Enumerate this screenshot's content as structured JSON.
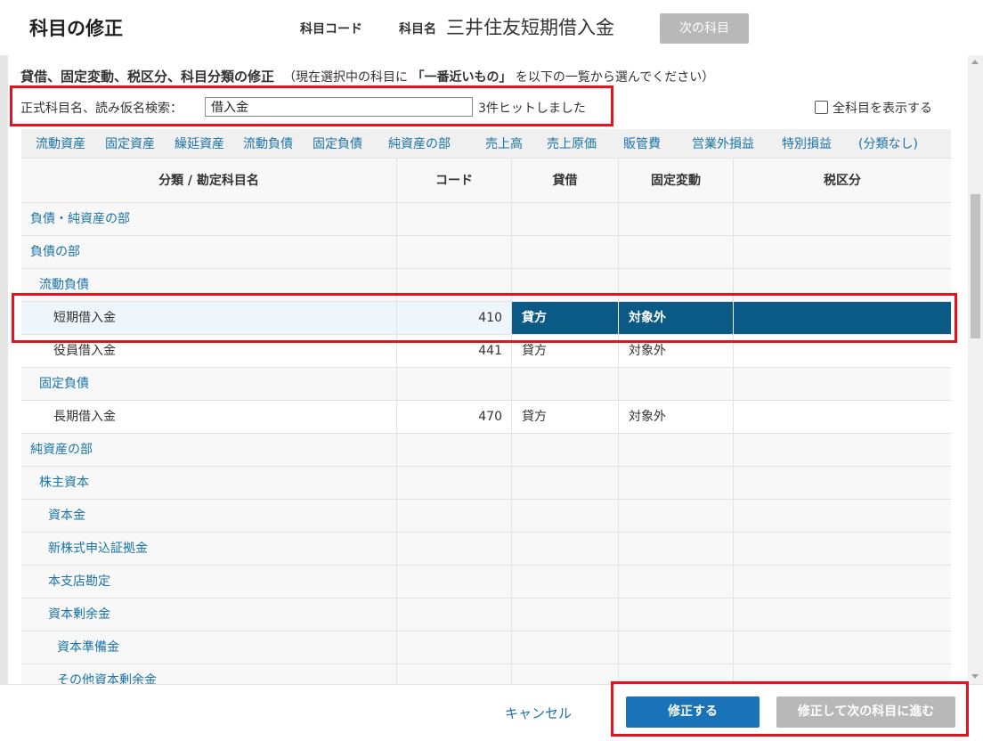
{
  "dialog": {
    "title": "科目の修正",
    "code_label": "科目コード",
    "name_label": "科目名",
    "name_value": "三井住友短期借入金",
    "next_button": "次の科目"
  },
  "section": {
    "title": "貸借、固定変動、税区分、科目分類の修正",
    "note_pre": "（現在選択中の科目に",
    "note_bold": "「一番近いもの」",
    "note_post": "を以下の一覧から選んでください）"
  },
  "search": {
    "label": "正式科目名、読み仮名検索：",
    "value": "借入金",
    "hit_text": "3件ヒットしました"
  },
  "show_all_label": "全科目を表示する",
  "categories": [
    "流動資産",
    "固定資産",
    "繰延資産",
    "流動負債",
    "固定負債",
    "純資産の部",
    "売上高",
    "売上原価",
    "販管費",
    "営業外損益",
    "特別損益",
    "(分類なし)"
  ],
  "table": {
    "headers": [
      "分類 / 勘定科目名",
      "コード",
      "貸借",
      "固定変動",
      "税区分"
    ],
    "rows": [
      {
        "name": "負債・純資産の部",
        "type": "category",
        "indent": 0,
        "code": "",
        "lr": "",
        "fixed": "",
        "tax": ""
      },
      {
        "name": "負債の部",
        "type": "category",
        "indent": 0,
        "code": "",
        "lr": "",
        "fixed": "",
        "tax": ""
      },
      {
        "name": "流動負債",
        "type": "category",
        "indent": 1,
        "code": "",
        "lr": "",
        "fixed": "",
        "tax": ""
      },
      {
        "name": "短期借入金",
        "type": "selected",
        "indent": 2,
        "code": "410",
        "lr": "貸方",
        "fixed": "対象外",
        "tax": ""
      },
      {
        "name": "役員借入金",
        "type": "account",
        "indent": 2,
        "code": "441",
        "lr": "貸方",
        "fixed": "対象外",
        "tax": ""
      },
      {
        "name": "固定負債",
        "type": "category",
        "indent": 1,
        "code": "",
        "lr": "",
        "fixed": "",
        "tax": ""
      },
      {
        "name": "長期借入金",
        "type": "account",
        "indent": 2,
        "code": "470",
        "lr": "貸方",
        "fixed": "対象外",
        "tax": ""
      },
      {
        "name": "純資産の部",
        "type": "category",
        "indent": 0,
        "code": "",
        "lr": "",
        "fixed": "",
        "tax": ""
      },
      {
        "name": "株主資本",
        "type": "category",
        "indent": 1,
        "code": "",
        "lr": "",
        "fixed": "",
        "tax": ""
      },
      {
        "name": "資本金",
        "type": "category",
        "indent": 2,
        "code": "",
        "lr": "",
        "fixed": "",
        "tax": ""
      },
      {
        "name": "新株式申込証拠金",
        "type": "category",
        "indent": 2,
        "code": "",
        "lr": "",
        "fixed": "",
        "tax": ""
      },
      {
        "name": "本支店勘定",
        "type": "category",
        "indent": 2,
        "code": "",
        "lr": "",
        "fixed": "",
        "tax": ""
      },
      {
        "name": "資本剰余金",
        "type": "category",
        "indent": 2,
        "code": "",
        "lr": "",
        "fixed": "",
        "tax": ""
      },
      {
        "name": "資本準備金",
        "type": "category",
        "indent": 3,
        "code": "",
        "lr": "",
        "fixed": "",
        "tax": ""
      },
      {
        "name": "その他資本剰余金",
        "type": "category",
        "indent": 3,
        "code": "",
        "lr": "",
        "fixed": "",
        "tax": ""
      }
    ]
  },
  "footer": {
    "cancel": "キャンセル",
    "submit": "修正する",
    "submit_next": "修正して次の科目に進む"
  },
  "colors": {
    "accent": "#1a73b8",
    "link": "#1a73a8",
    "selected_fill": "#0a5a85",
    "highlight_box": "#e5131d",
    "disabled_button": "#b8b8b8"
  }
}
